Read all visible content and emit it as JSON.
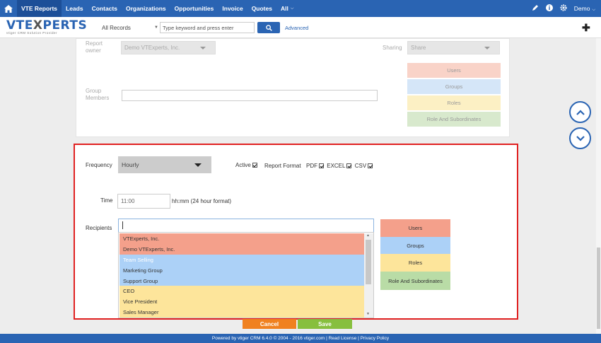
{
  "nav": {
    "items": [
      "VTE Reports",
      "Leads",
      "Contacts",
      "Organizations",
      "Opportunities",
      "Invoice",
      "Quotes",
      "All"
    ],
    "user": "Demo"
  },
  "subbar": {
    "logo_main": "VTEXPERTS",
    "logo_tag": "vtiger CRM Solution Provider",
    "records_select": "All Records",
    "search_placeholder": "Type keyword and press enter",
    "advanced": "Advanced"
  },
  "upper": {
    "report_owner_label": "Report owner",
    "report_owner_value": "Demo VTExperts, Inc.",
    "sharing_label": "Sharing",
    "sharing_value": "Share",
    "group_members_label": "Group Members",
    "chips": [
      "Users",
      "Groups",
      "Roles",
      "Role And Subordinates"
    ]
  },
  "schedule": {
    "frequency_label": "Frequency",
    "frequency_value": "Hourly",
    "active_label": "Active",
    "report_format_label": "Report Format",
    "formats": [
      "PDF",
      "EXCEL",
      "CSV"
    ],
    "time_label": "Time",
    "time_value": "11:00",
    "time_hint": "hh:mm (24 hour format)",
    "recipients_label": "Recipients",
    "chips": [
      "Users",
      "Groups",
      "Roles",
      "Role And Subordinates"
    ],
    "dropdown": [
      {
        "label": "VTExperts, Inc.",
        "kind": "users"
      },
      {
        "label": "Demo VTExperts, Inc.",
        "kind": "users"
      },
      {
        "label": "Team Selling",
        "kind": "groups"
      },
      {
        "label": "Marketing Group",
        "kind": "groups"
      },
      {
        "label": "Support Group",
        "kind": "groups"
      },
      {
        "label": "CEO",
        "kind": "roles"
      },
      {
        "label": "Vice President",
        "kind": "roles"
      },
      {
        "label": "Sales Manager",
        "kind": "roles"
      }
    ]
  },
  "actions": {
    "cancel": "Cancel",
    "save": "Save"
  },
  "footer": "Powered by vtiger CRM 6.4.0 © 2004 - 2016 vtiger.com | Read License | Privacy Policy",
  "colors": {
    "nav_blue": "#2a64b3",
    "users": "#f4a08b",
    "groups": "#acd1f7",
    "roles": "#fde59b",
    "role_subordinates": "#b9dca6",
    "cancel": "#f0811f",
    "save": "#87bf3e",
    "highlight_border": "#e02020"
  }
}
